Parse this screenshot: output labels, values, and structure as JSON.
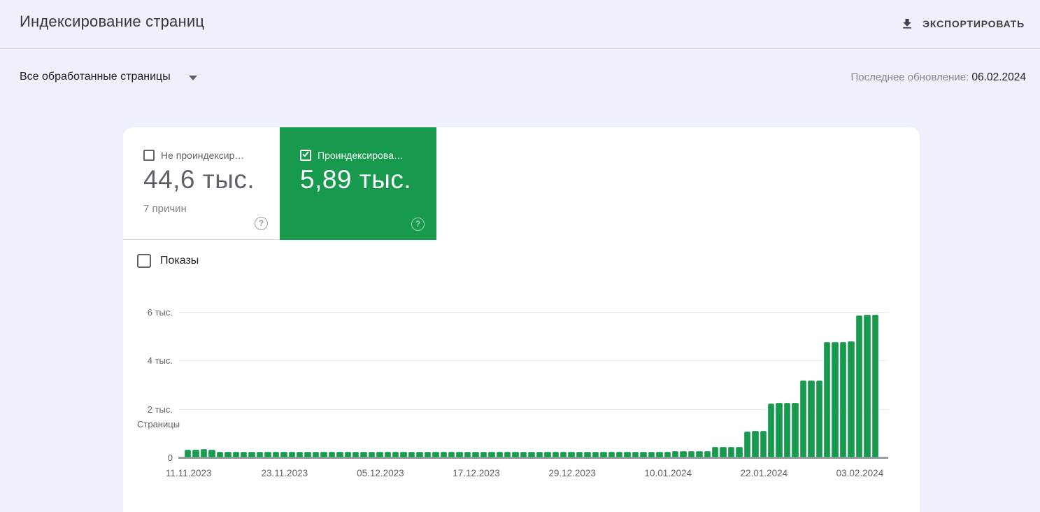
{
  "header": {
    "title": "Индексирование страниц",
    "export_label": "ЭКСПОРТИРОВАТЬ"
  },
  "toolbar": {
    "filter_label": "Все обработанные страницы",
    "last_update_label": "Последнее обновление:",
    "last_update_date": "06.02.2024"
  },
  "icons": {
    "help": "?"
  },
  "tiles": {
    "not_indexed": {
      "label": "Не проиндексир…",
      "value": "44,6 тыс.",
      "sublabel": "7 причин",
      "checked": false
    },
    "indexed": {
      "label": "Проиндексирова…",
      "value": "5,89 тыс.",
      "checked": true,
      "color": "#189a4e"
    }
  },
  "impressions_toggle": {
    "label": "Показы",
    "checked": false
  },
  "chart_data": {
    "type": "bar",
    "title": "Страницы",
    "ylabel": "Страницы",
    "bar_color": "#189a4e",
    "ylim": [
      0,
      6000
    ],
    "grid": true,
    "yticks": [
      {
        "value": 0,
        "label": "0"
      },
      {
        "value": 2000,
        "label": "2 тыс."
      },
      {
        "value": 4000,
        "label": "4 тыс."
      },
      {
        "value": 6000,
        "label": "6 тыс."
      }
    ],
    "x_tick_labels": [
      "11.11.2023",
      "23.11.2023",
      "05.12.2023",
      "17.12.2023",
      "29.12.2023",
      "10.01.2024",
      "22.01.2024",
      "03.02.2024"
    ],
    "x_tick_indices": [
      0,
      12,
      24,
      36,
      48,
      60,
      72,
      84
    ],
    "x_range": [
      "11.11.2023",
      "05.02.2024"
    ],
    "values": [
      320,
      330,
      335,
      325,
      245,
      240,
      240,
      235,
      240,
      245,
      240,
      238,
      242,
      240,
      236,
      240,
      238,
      242,
      240,
      237,
      241,
      239,
      243,
      240,
      238,
      240,
      242,
      236,
      240,
      238,
      242,
      240,
      236,
      240,
      239,
      241,
      238,
      240,
      242,
      240,
      237,
      239,
      241,
      238,
      235,
      232,
      230,
      228,
      230,
      232,
      228,
      230,
      226,
      228,
      230,
      232,
      235,
      238,
      240,
      242,
      245,
      248,
      250,
      252,
      255,
      258,
      420,
      430,
      435,
      440,
      1080,
      1090,
      1100,
      2230,
      2250,
      2240,
      2260,
      3160,
      3180,
      3170,
      4750,
      4770,
      4760,
      4780,
      5870,
      5890,
      5890
    ]
  }
}
